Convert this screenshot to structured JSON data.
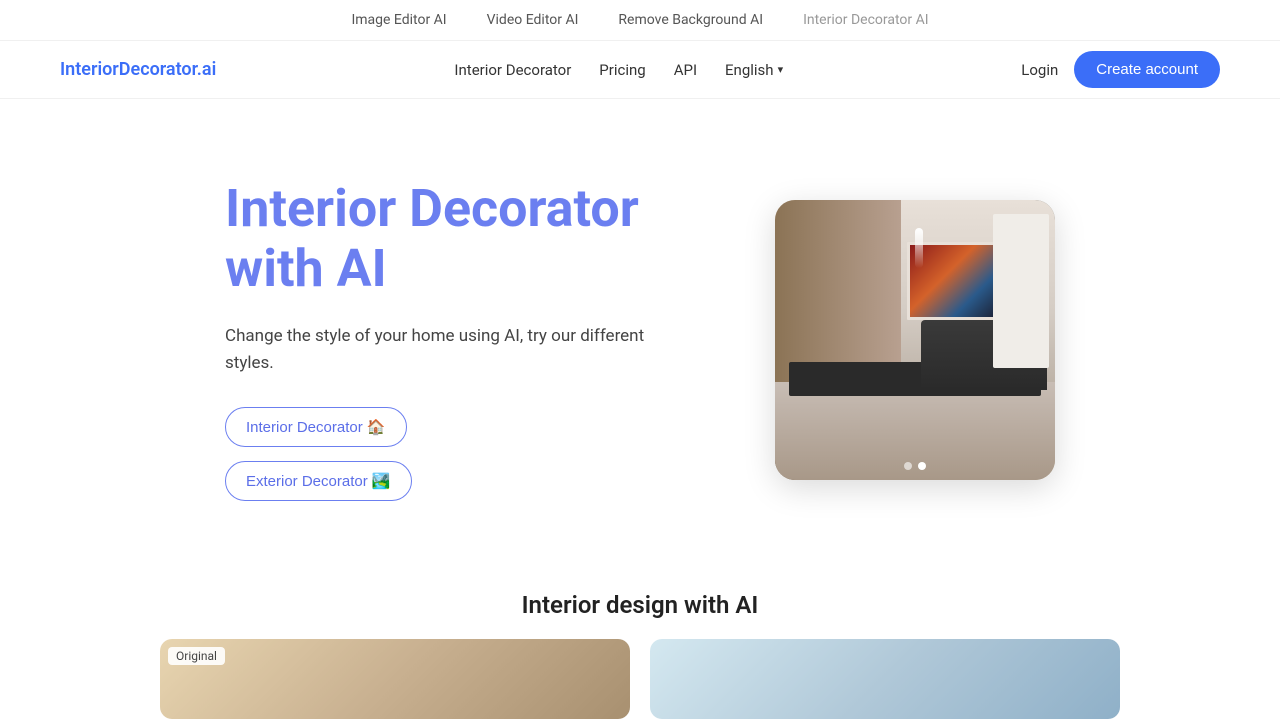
{
  "topbar": {
    "links": [
      {
        "label": "Image Editor AI",
        "active": false
      },
      {
        "label": "Video Editor AI",
        "active": false
      },
      {
        "label": "Remove Background AI",
        "active": false
      },
      {
        "label": "Interior Decorator AI",
        "active": true
      }
    ]
  },
  "nav": {
    "logo": "InteriorDecorator.ai",
    "links": [
      {
        "label": "Interior Decorator"
      },
      {
        "label": "Pricing"
      },
      {
        "label": "API"
      },
      {
        "label": "English",
        "hasDropdown": true
      }
    ],
    "login_label": "Login",
    "create_label": "Create account"
  },
  "hero": {
    "title": "Interior Decorator with AI",
    "subtitle": "Change the style of your home using AI, try our different styles.",
    "btn_interior": "Interior Decorator 🏠",
    "btn_exterior": "Exterior Decorator 🏞️",
    "carousel_dots": [
      {
        "active": false
      },
      {
        "active": true
      }
    ]
  },
  "section": {
    "title": "Interior design with AI"
  },
  "preview": {
    "original_badge": "Original"
  }
}
